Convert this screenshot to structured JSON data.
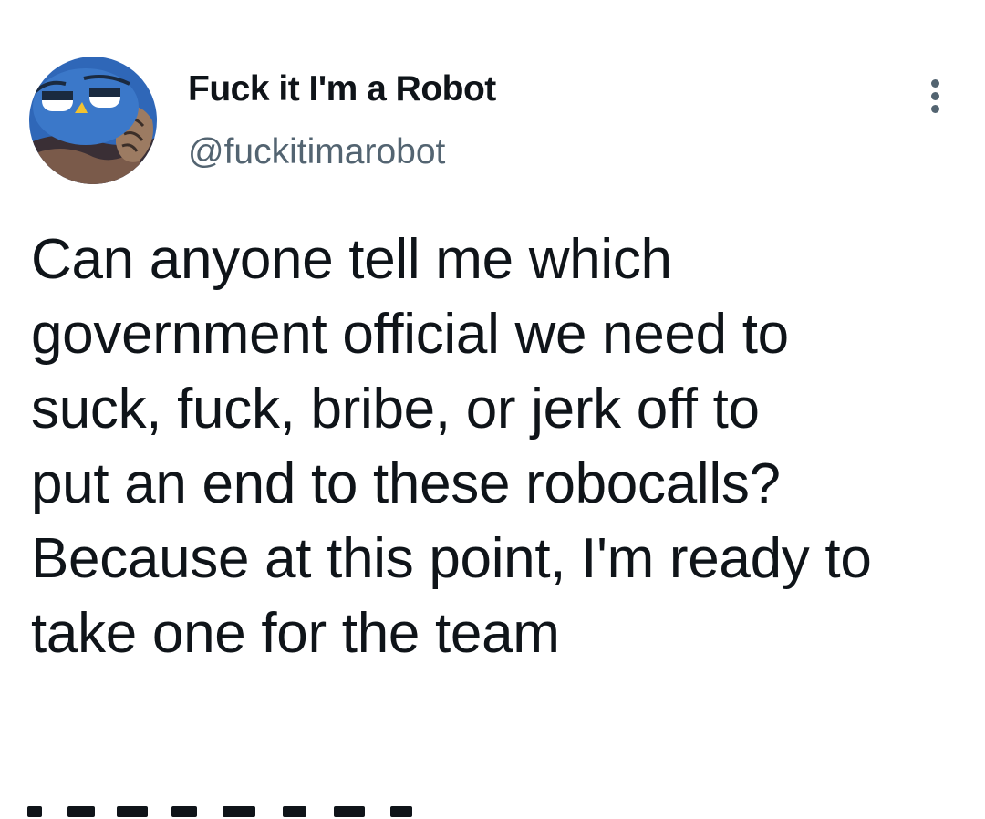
{
  "author": {
    "display_name": "Fuck it I'm a Robot",
    "handle": "@fuckitimarobot",
    "avatar_icon": "robot-face-avatar"
  },
  "menu": {
    "icon": "more-vertical-icon"
  },
  "tweet": {
    "lines": [
      "Can anyone tell me which",
      "government official we need to",
      "suck, fuck, bribe, or jerk off to",
      "put an end to these robocalls?",
      "Because at this point, I'm ready to",
      "take one for the team"
    ]
  },
  "colors": {
    "text_primary": "#0f1419",
    "text_secondary": "#536471",
    "background": "#ffffff"
  }
}
